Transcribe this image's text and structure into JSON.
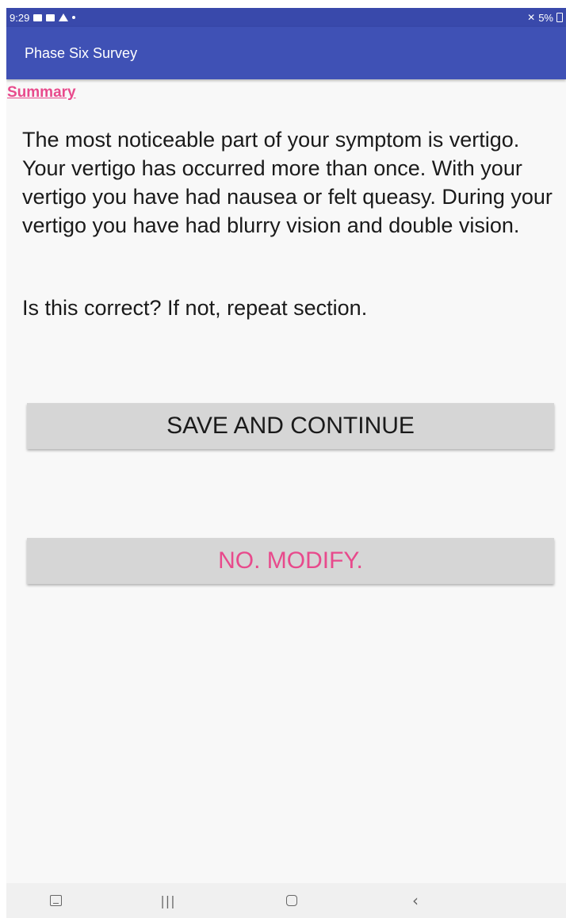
{
  "status_bar": {
    "time": "9:29",
    "battery_text": "5%",
    "icons": [
      "image-icon",
      "notification-icon",
      "warning-icon",
      "dot-icon",
      "mute-icon",
      "battery-icon"
    ]
  },
  "app_bar": {
    "title": "Phase Six Survey"
  },
  "content": {
    "section_link": "Summary",
    "summary_text": "The most noticeable part of your symptom is vertigo. Your vertigo has occurred more than once. With your vertigo you have had nausea or felt queasy. During your vertigo you have had blurry vision and double vision.",
    "question": "Is this correct? If not, repeat section."
  },
  "buttons": {
    "save_label": "SAVE AND CONTINUE",
    "modify_label": "NO. MODIFY."
  },
  "nav_bar": {
    "icons": [
      "keyboard-icon",
      "recents-icon",
      "home-icon",
      "back-icon"
    ]
  },
  "colors": {
    "primary": "#3f51b5",
    "status_bar": "#3949ab",
    "accent": "#e84a8c",
    "button_bg": "#d6d6d6",
    "background": "#f8f8f8"
  }
}
